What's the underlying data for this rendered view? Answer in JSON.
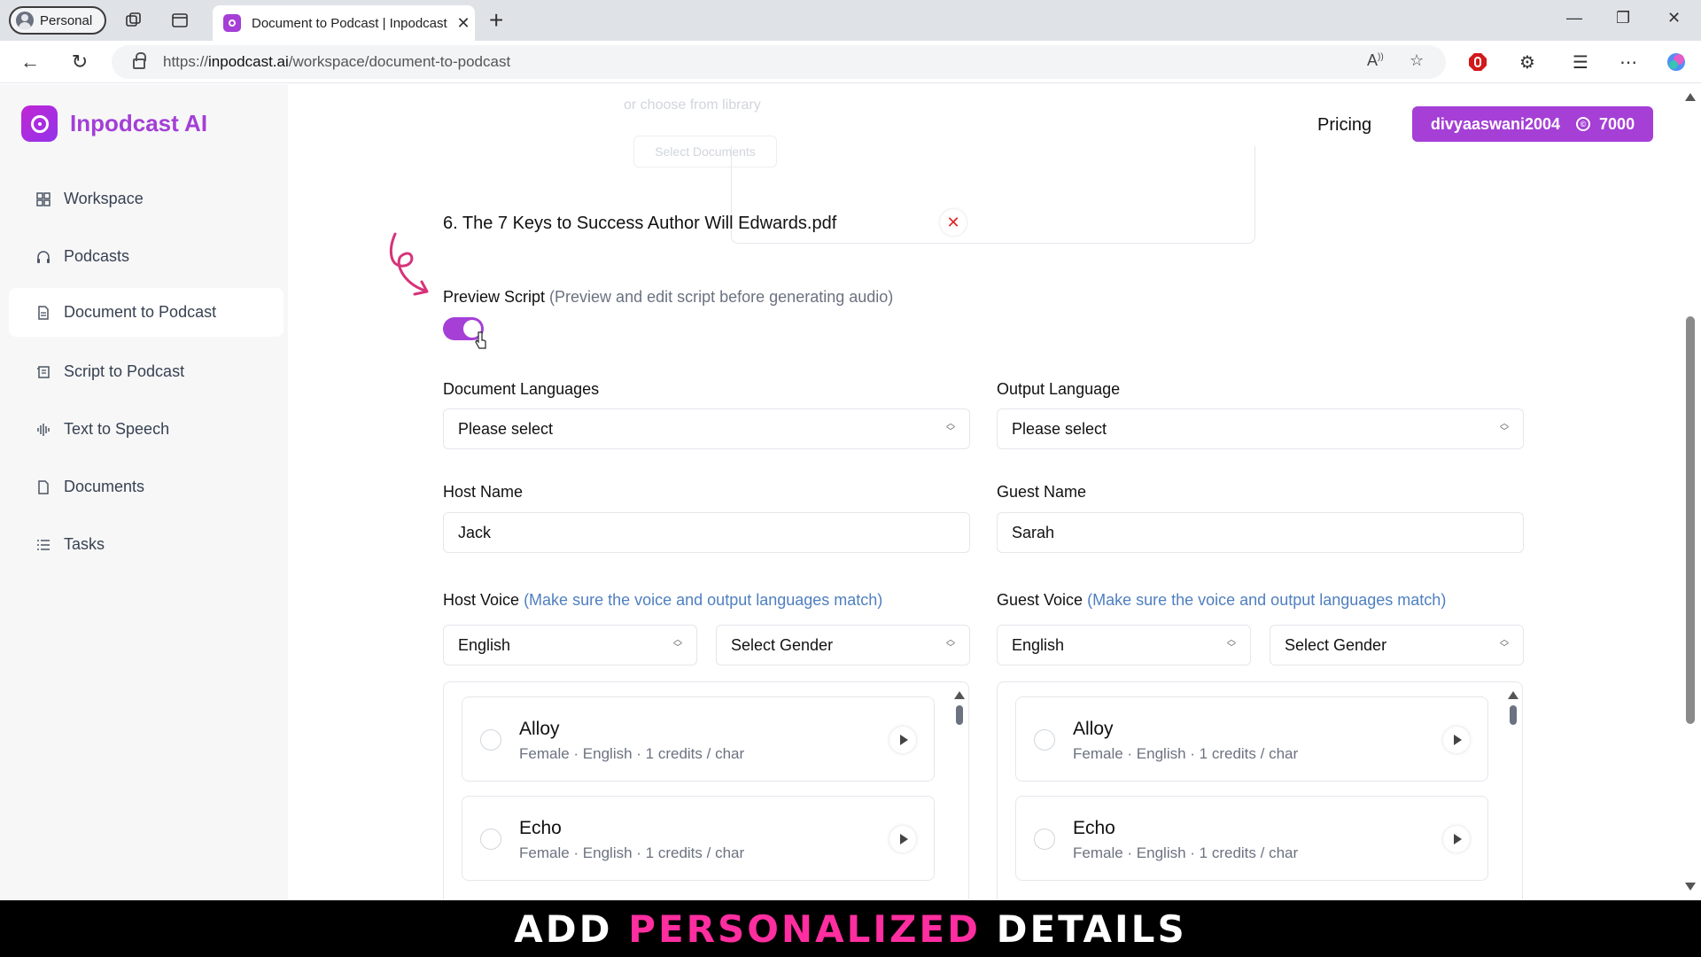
{
  "browser": {
    "profile_label": "Personal",
    "tab_title": "Document to Podcast | Inpodcast",
    "url_prefix": "https://",
    "url_host": "inpodcast.ai",
    "url_path": "/workspace/document-to-podcast"
  },
  "app": {
    "name": "Inpodcast AI",
    "pricing": "Pricing",
    "username": "divyaaswani2004",
    "credits": "7000",
    "accent_color": "#a53fd6"
  },
  "sidebar": {
    "items": [
      {
        "label": "Workspace",
        "icon": "grid-icon"
      },
      {
        "label": "Podcasts",
        "icon": "headphones-icon"
      },
      {
        "label": "Document to Podcast",
        "icon": "document-icon",
        "active": true
      },
      {
        "label": "Script to Podcast",
        "icon": "script-icon"
      },
      {
        "label": "Text to Speech",
        "icon": "waveform-icon"
      },
      {
        "label": "Documents",
        "icon": "file-icon"
      },
      {
        "label": "Tasks",
        "icon": "tasks-icon"
      }
    ]
  },
  "upload": {
    "choose_text": "or choose from library",
    "select_button": "Select Documents",
    "file": "6. The 7 Keys to Success Author Will Edwards.pdf"
  },
  "preview": {
    "label": "Preview Script",
    "hint": "(Preview and edit script before generating audio)",
    "enabled": true
  },
  "form": {
    "doc_lang_label": "Document Languages",
    "doc_lang_value": "Please select",
    "out_lang_label": "Output Language",
    "out_lang_value": "Please select",
    "host_name_label": "Host Name",
    "host_name_value": "Jack",
    "guest_name_label": "Guest Name",
    "guest_name_value": "Sarah",
    "host_voice_label": "Host Voice",
    "guest_voice_label": "Guest Voice",
    "voice_hint": "(Make sure the voice and output languages match)",
    "host_voice_lang": "English",
    "host_voice_gender": "Select Gender",
    "guest_voice_lang": "English",
    "guest_voice_gender": "Select Gender"
  },
  "voices": [
    {
      "name": "Alloy",
      "meta": "Female · English · 1 credits / char"
    },
    {
      "name": "Echo",
      "meta": "Female · English · 1 credits / char"
    }
  ],
  "caption": {
    "part1": "ADD",
    "part2": "PERSONALIZED",
    "part3": "DETAILS"
  }
}
